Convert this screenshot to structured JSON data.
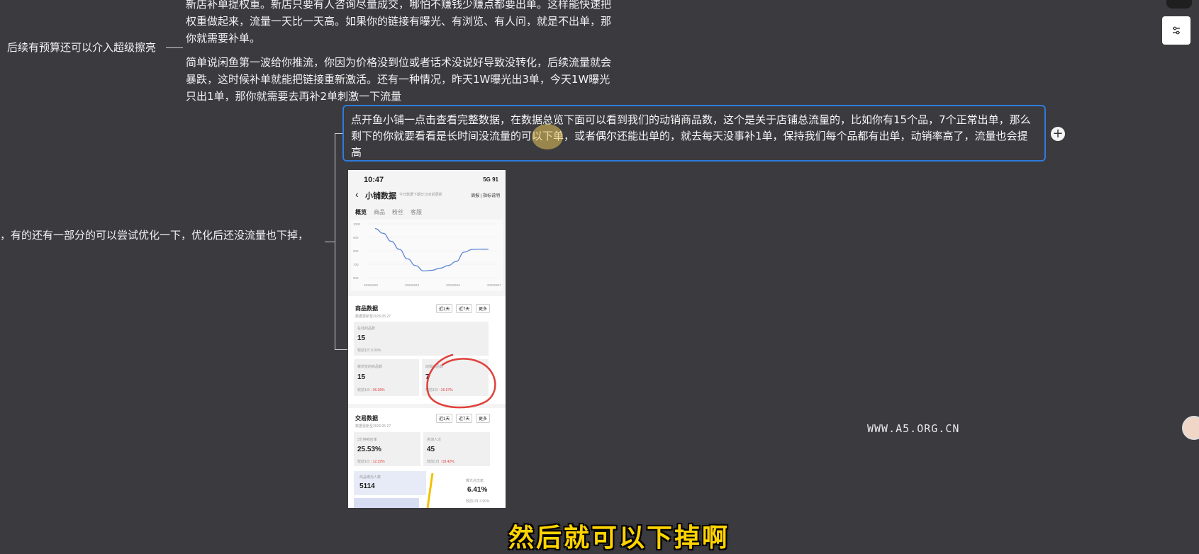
{
  "mindmap": {
    "top_paragraph_1": [
      "新店补单提权重。新店只要有人咨询尽量成交，哪怕不赚钱少赚点都要出单。这样能快速把",
      "权重做起来，流量一天比一天高。如果你的链接有曝光、有浏览、有人问，就是不出单，那",
      "你就需要补单。"
    ],
    "top_paragraph_2": [
      "简单说闲鱼第一波给你推流，你因为价格没到位或者话术没说好导致没转化，后续流量就会",
      "暴跌，这时候补单就能把链接重新激活。还有一种情况，昨天1W曝光出3单，今天1W曝光",
      "只出1单，那你就需要去再补2单刺激一下流量"
    ],
    "left_node_1": "后续有预算还可以介入超级擦亮",
    "left_node_2": "，有的还有一部分的可以尝试优化一下，优化后还没流量也下掉，",
    "selected_node": [
      "点开鱼小铺一点击查看完整数据，在数据总览下面可以看到我们的动销商品数，这个是关于店铺总流量的，比如你有15个品，7个正常出单，那么",
      "剩下的你就要看看是长时间没流量的可以下单，或者偶尔还能出单的，就去每天没事补1单，保持我们每个品都有出单，动销率高了，流量也会提",
      "高"
    ],
    "plus_label": "+"
  },
  "phone": {
    "time": "10:47",
    "status_right": "5G 91",
    "back_icon": "‹",
    "title": "小铺数据",
    "title_sub": "今日数据下期日15点前更新",
    "title_right": "周报 | 指标说明",
    "tabs": [
      "概览",
      "商品",
      "粉丝",
      "客服"
    ],
    "chart_data": {
      "type": "line",
      "x": [
        "20260520",
        "20260523",
        "20260525",
        "20260527"
      ],
      "y_ticks": [
        "1000",
        "900",
        "800",
        "700",
        "600"
      ],
      "series": [
        {
          "values": [
            965,
            930,
            870,
            810,
            740,
            690,
            650,
            655,
            670,
            690,
            720,
            790,
            810,
            812,
            811
          ]
        }
      ],
      "ylim": [
        600,
        1000
      ]
    },
    "goods": {
      "title": "商品数据",
      "sub": "数据更新至2026.05.27",
      "chips": [
        "近1天",
        "近7天",
        "更多"
      ],
      "online_label": "在线商品数",
      "online_value": "15",
      "online_cmp": "较前1日 0.00%",
      "browse_label": "被浏览的商品数",
      "browse_value": "15",
      "browse_cmp_prefix": "较前1日 ",
      "browse_cmp": "↑36.36%",
      "sales_label": "动销商品数",
      "sales_value": "7",
      "sales_cmp_prefix": "较前1日 ",
      "sales_cmp": "↑16.67%"
    },
    "trade": {
      "title": "交易数据",
      "sub": "数据更新至2026.05.27",
      "chips": [
        "近1天",
        "近7天",
        "更多"
      ],
      "rate_label": "3分钟响应率",
      "rate_value": "25.53%",
      "rate_cmp_prefix": "较前1日 ",
      "rate_cmp": "↑12.32%",
      "consult_label": "咨询人次",
      "consult_value": "45",
      "consult_cmp_prefix": "较前1日 ",
      "consult_cmp": "↑18.42%",
      "expose_label": "商品曝光人数",
      "expose_value": "5114",
      "click_label": "曝光点击率",
      "click_value": "6.41%",
      "click_cmp": "较前1日 3.90%"
    }
  },
  "watermark": "WWW.A5.ORG.CN",
  "subtitle": "然后就可以下掉啊",
  "colors": {
    "background": "#3a3a3f",
    "selection_border": "#2f7bdc",
    "subtitle": "#ffd400",
    "annotation_circle": "#e0403a"
  }
}
